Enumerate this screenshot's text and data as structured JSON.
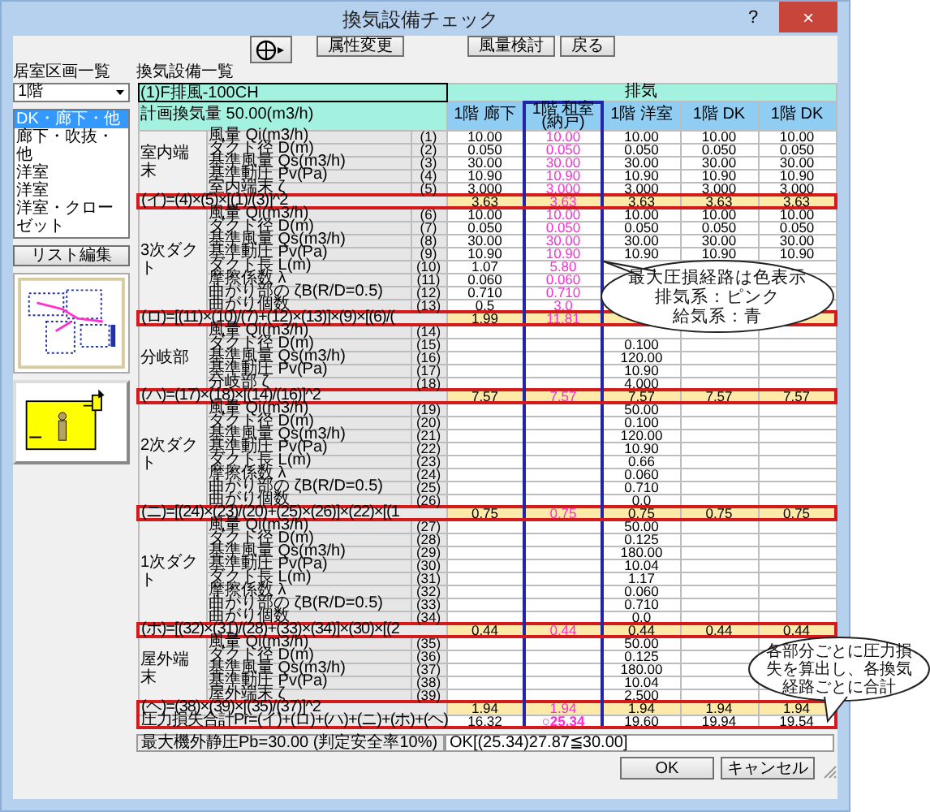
{
  "window": {
    "title": "換気設備チェック",
    "help": "?",
    "close": "×"
  },
  "toolbar": {
    "buttons": [
      "属性変更",
      "風量検討",
      "戻る"
    ]
  },
  "left_panel": {
    "title": "居室区画一覧",
    "floor": "1階",
    "rooms": [
      {
        "label": "DK・廊下・他",
        "selected": true
      },
      {
        "label": "廊下・吹抜・他",
        "selected": false
      },
      {
        "label": "洋室",
        "selected": false
      },
      {
        "label": "洋室",
        "selected": false
      },
      {
        "label": "洋室・クローゼット",
        "selected": false
      }
    ],
    "edit_button": "リスト編集"
  },
  "equipment": {
    "title": "換気設備一覧",
    "unit": "(1)F排風-100CH",
    "system": "排気",
    "planned_airflow": "計画換気量 50.00(m3/h)",
    "columns": [
      {
        "name": "1階 廊下",
        "highlighted": false
      },
      {
        "name": "1階 和室(納戸)",
        "highlighted": true
      },
      {
        "name": "1階 洋室",
        "highlighted": false
      },
      {
        "name": "1階 DK",
        "highlighted": false
      },
      {
        "name": "1階 DK",
        "highlighted": false
      }
    ],
    "sections": [
      {
        "name": "室内端末",
        "rows": [
          {
            "label": "風量 Qi(m3/h)",
            "no": "(1)",
            "cells": {
              "col_1": "10.00",
              "col_2": "10.00",
              "col_3": "10.00",
              "col_4": "10.00",
              "col_5": "10.00"
            }
          },
          {
            "label": "ダクト径 D(m)",
            "no": "(2)",
            "cells": {
              "col_1": "0.050",
              "col_2": "0.050",
              "col_3": "0.050",
              "col_4": "0.050",
              "col_5": "0.050"
            }
          },
          {
            "label": "基準風量 Qs(m3/h)",
            "no": "(3)",
            "cells": {
              "col_1": "30.00",
              "col_2": "30.00",
              "col_3": "30.00",
              "col_4": "30.00",
              "col_5": "30.00"
            }
          },
          {
            "label": "基準動圧 Pv(Pa)",
            "no": "(4)",
            "cells": {
              "col_1": "10.90",
              "col_2": "10.90",
              "col_3": "10.90",
              "col_4": "10.90",
              "col_5": "10.90"
            }
          },
          {
            "label": "室内端末 ζ",
            "no": "(5)",
            "cells": {
              "col_1": "3.000",
              "col_2": "3.000",
              "col_3": "3.000",
              "col_4": "3.000",
              "col_5": "3.000"
            }
          }
        ],
        "sum": {
          "formula": "(イ)=(4)×(5)×[(1)/(3)]^2",
          "cells": {
            "col_1": "3.63",
            "col_2": "3.63",
            "col_3": "3.63",
            "col_4": "3.63",
            "col_5": "3.63"
          }
        }
      },
      {
        "name": "3次ダクト",
        "rows": [
          {
            "label": "風量 Qi(m3/h)",
            "no": "(6)",
            "cells": {
              "col_1": "10.00",
              "col_2": "10.00",
              "col_3": "10.00",
              "col_4": "10.00",
              "col_5": "10.00"
            }
          },
          {
            "label": "ダクト径 D(m)",
            "no": "(7)",
            "cells": {
              "col_1": "0.050",
              "col_2": "0.050",
              "col_3": "0.050",
              "col_4": "0.050",
              "col_5": "0.050"
            }
          },
          {
            "label": "基準風量 Qs(m3/h)",
            "no": "(8)",
            "cells": {
              "col_1": "30.00",
              "col_2": "30.00",
              "col_3": "30.00",
              "col_4": "30.00",
              "col_5": "30.00"
            }
          },
          {
            "label": "基準動圧 Pv(Pa)",
            "no": "(9)",
            "cells": {
              "col_1": "10.90",
              "col_2": "10.90",
              "col_3": "10.90",
              "col_4": "10.90",
              "col_5": "10.90"
            }
          },
          {
            "label": "ダクト長 L(m)",
            "no": "(10)",
            "cells": {
              "col_1": "1.07",
              "col_2": "5.80"
            }
          },
          {
            "label": "摩擦係数 λ",
            "no": "(11)",
            "cells": {
              "col_1": "0.060",
              "col_2": "0.060"
            }
          },
          {
            "label": "曲がり部の ζB(R/D=0.5)",
            "no": "(12)",
            "cells": {
              "col_1": "0.710",
              "col_2": "0.710"
            }
          },
          {
            "label": "曲がり個数",
            "no": "(13)",
            "cells": {
              "col_1": "0.5",
              "col_2": "3.0"
            }
          }
        ],
        "sum": {
          "formula": "(ロ)=[(11)×(10)/(7)+(12)×(13)]×(9)×[(6)/(",
          "cells": {
            "col_1": "1.99",
            "col_2": "11.81"
          }
        }
      },
      {
        "name": "分岐部",
        "rows": [
          {
            "label": "風量 Qi(m3/h)",
            "no": "(14)",
            "cells": {}
          },
          {
            "label": "ダクト径 D(m)",
            "no": "(15)",
            "cells": {
              "col_3": "0.100"
            }
          },
          {
            "label": "基準風量 Qs(m3/h)",
            "no": "(16)",
            "cells": {
              "col_3": "120.00"
            }
          },
          {
            "label": "基準動圧 Pv(Pa)",
            "no": "(17)",
            "cells": {
              "col_3": "10.90"
            }
          },
          {
            "label": "分岐部 ζ",
            "no": "(18)",
            "cells": {
              "col_3": "4.000"
            }
          }
        ],
        "sum": {
          "formula": "(ハ)=(17)×(18)×[(14)/(16)]^2",
          "cells": {
            "col_1": "7.57",
            "col_2": "7.57",
            "col_3": "7.57",
            "col_4": "7.57",
            "col_5": "7.57"
          }
        }
      },
      {
        "name": "2次ダクト",
        "rows": [
          {
            "label": "風量 Qi(m3/h)",
            "no": "(19)",
            "cells": {
              "col_3": "50.00"
            }
          },
          {
            "label": "ダクト径 D(m)",
            "no": "(20)",
            "cells": {
              "col_3": "0.100"
            }
          },
          {
            "label": "基準風量 Qs(m3/h)",
            "no": "(21)",
            "cells": {
              "col_3": "120.00"
            }
          },
          {
            "label": "基準動圧 Pv(Pa)",
            "no": "(22)",
            "cells": {
              "col_3": "10.90"
            }
          },
          {
            "label": "ダクト長 L(m)",
            "no": "(23)",
            "cells": {
              "col_3": "0.66"
            }
          },
          {
            "label": "摩擦係数 λ",
            "no": "(24)",
            "cells": {
              "col_3": "0.060"
            }
          },
          {
            "label": "曲がり部の ζB(R/D=0.5)",
            "no": "(25)",
            "cells": {
              "col_3": "0.710"
            }
          },
          {
            "label": "曲がり個数",
            "no": "(26)",
            "cells": {
              "col_3": "0.0"
            }
          }
        ],
        "sum": {
          "formula": "(ニ)=[(24)×(23)/(20)+(25)×(26)]×(22)×[(1",
          "cells": {
            "col_1": "0.75",
            "col_2": "0.75",
            "col_3": "0.75",
            "col_4": "0.75",
            "col_5": "0.75"
          }
        }
      },
      {
        "name": "1次ダクト",
        "rows": [
          {
            "label": "風量 Qi(m3/h)",
            "no": "(27)",
            "cells": {
              "col_3": "50.00"
            }
          },
          {
            "label": "ダクト径 D(m)",
            "no": "(28)",
            "cells": {
              "col_3": "0.125"
            }
          },
          {
            "label": "基準風量 Qs(m3/h)",
            "no": "(29)",
            "cells": {
              "col_3": "180.00"
            }
          },
          {
            "label": "基準動圧 Pv(Pa)",
            "no": "(30)",
            "cells": {
              "col_3": "10.04"
            }
          },
          {
            "label": "ダクト長 L(m)",
            "no": "(31)",
            "cells": {
              "col_3": "1.17"
            }
          },
          {
            "label": "摩擦係数 λ",
            "no": "(32)",
            "cells": {
              "col_3": "0.060"
            }
          },
          {
            "label": "曲がり部の ζB(R/D=0.5)",
            "no": "(33)",
            "cells": {
              "col_3": "0.710"
            }
          },
          {
            "label": "曲がり個数",
            "no": "(34)",
            "cells": {
              "col_3": "0.0"
            }
          }
        ],
        "sum": {
          "formula": "(ホ)=[(32)×(31)/(28)+(33)×(34)]×(30)×[(2",
          "cells": {
            "col_1": "0.44",
            "col_2": "0.44",
            "col_3": "0.44",
            "col_4": "0.44",
            "col_5": "0.44"
          }
        }
      },
      {
        "name": "屋外端末",
        "rows": [
          {
            "label": "風量 Qi(m3/h)",
            "no": "(35)",
            "cells": {
              "col_3": "50.00"
            }
          },
          {
            "label": "ダクト径 D(m)",
            "no": "(36)",
            "cells": {
              "col_3": "0.125"
            }
          },
          {
            "label": "基準風量 Qs(m3/h)",
            "no": "(37)",
            "cells": {
              "col_3": "180.00"
            }
          },
          {
            "label": "基準動圧 Pv(Pa)",
            "no": "(38)",
            "cells": {
              "col_3": "10.04"
            }
          },
          {
            "label": "屋外端末 ζ",
            "no": "(39)",
            "cells": {
              "col_3": "2.500"
            }
          }
        ],
        "sum": {
          "formula": "(ヘ)=(38)×(39)×[(35)/(37)]^2",
          "cells": {
            "col_1": "1.94",
            "col_2": "1.94",
            "col_3": "1.94",
            "col_4": "1.94",
            "col_5": "1.94"
          }
        }
      }
    ],
    "total": {
      "label": "圧力損失合計Pr=(イ)+(ロ)+(ハ)+(ニ)+(ホ)+(ヘ)",
      "cells": {
        "col_1": "16.32",
        "col_2": "○25.34",
        "col_3": "19.60",
        "col_4": "19.94",
        "col_5": "19.54"
      }
    },
    "max_static": {
      "label": "最大機外静圧Pb=30.00 (判定安全率10%)",
      "value": "OK[(25.34)27.87≦30.00]"
    }
  },
  "callouts": [
    {
      "lines": [
        "最大圧損経路は色表示",
        "排気系：ピンク",
        "給気系：青"
      ]
    },
    {
      "lines": [
        "各部分ごとに圧力損",
        "失を算出し、各換気",
        "経路ごとに合計"
      ]
    }
  ],
  "buttons": [
    "OK",
    "キャンセル"
  ]
}
